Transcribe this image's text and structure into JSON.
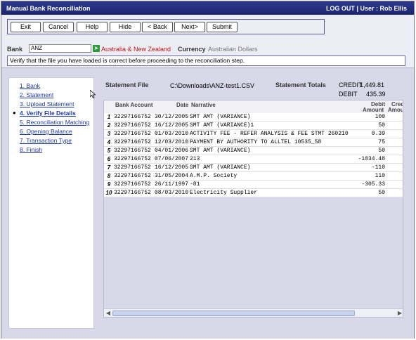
{
  "app": {
    "title": "Manual Bank Reconciliation",
    "logout_label": "LOG OUT",
    "user_label": "| User : Rob Ellis"
  },
  "toolbar": {
    "buttons": [
      {
        "label": "Exit"
      },
      {
        "label": "Cancel"
      },
      {
        "label": "Help"
      },
      {
        "label": "Hide"
      },
      {
        "label": "< Back"
      },
      {
        "label": "Next>"
      },
      {
        "label": "Submit"
      }
    ]
  },
  "bank": {
    "label": "Bank",
    "selected": "ANZ",
    "region": "Australia & New Zealand",
    "currency_label": "Currency",
    "currency_value": "Australian Dollars"
  },
  "info": "Verify that the file you have loaded is correct before proceeding to the reconciliation step.",
  "steps": [
    {
      "label": "1. Bank"
    },
    {
      "label": "2. Statement"
    },
    {
      "label": "3. Upload Statement"
    },
    {
      "label": "4. Verify File Details"
    },
    {
      "label": "5. Reconciliation Matching"
    },
    {
      "label": "6. Opening Balance"
    },
    {
      "label": "7. Transaction Type"
    },
    {
      "label": "8. Finish"
    }
  ],
  "statement": {
    "file_label": "Statement File",
    "file_path": "C:\\Downloads\\ANZ-test1.CSV",
    "totals_label": "Statement Totals",
    "credit_label": "CREDIT",
    "credit_value": "1,449.81",
    "debit_label": "DEBIT",
    "debit_value": "435.39"
  },
  "grid": {
    "headers": {
      "account": "Bank Account",
      "date": "Date",
      "narrative": "Narrative",
      "debit_line1": "Debit",
      "debit_line2": "Amount",
      "credit_line1": "Cred",
      "credit_line2": "Amou"
    },
    "rows": [
      {
        "num": "1",
        "account": "32297166752",
        "date": "30/12/2005",
        "narrative": "SMT AMT (VARIANCE)",
        "debit": "100"
      },
      {
        "num": "2",
        "account": "32297166752",
        "date": "16/12/2005",
        "narrative": "SMT AMT (VARIANCE)1",
        "debit": "50"
      },
      {
        "num": "3",
        "account": "32297166752",
        "date": "01/03/2010",
        "narrative": "ACTIVITY FEE - REFER ANALYSIS & FEE STMT 260210",
        "debit": "0.39"
      },
      {
        "num": "4",
        "account": "32297166752",
        "date": "12/03/2010",
        "narrative": "PAYMENT BY AUTHORITY TO ALLTEL 10535_58",
        "debit": "75"
      },
      {
        "num": "5",
        "account": "32297166752",
        "date": "04/01/2006",
        "narrative": "SMT AMT (VARIANCE)",
        "debit": "50"
      },
      {
        "num": "6",
        "account": "32297166752",
        "date": "07/06/2007",
        "narrative": "213",
        "debit": "-1034.48"
      },
      {
        "num": "7",
        "account": "32297166752",
        "date": "16/12/2005",
        "narrative": "SMT AMT (VARIANCE)",
        "debit": "-110"
      },
      {
        "num": "8",
        "account": "32297166752",
        "date": "31/05/2004",
        "narrative": "A.M.P. Society",
        "debit": "110"
      },
      {
        "num": "9",
        "account": "32297166752",
        "date": "26/11/1997",
        "narrative": "-81",
        "debit": "-305.33"
      },
      {
        "num": "10",
        "account": "32297166752",
        "date": "08/03/2010",
        "narrative": "Electricity Supplier",
        "debit": "50"
      }
    ]
  },
  "colors": {
    "titlebar": "#1b2470",
    "link": "#1f3a9e",
    "region": "#c01818",
    "panel": "#d8d8e8"
  }
}
